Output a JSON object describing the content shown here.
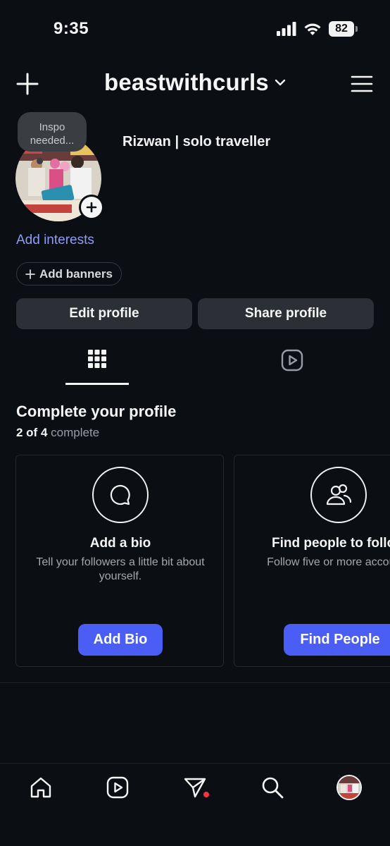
{
  "status_bar": {
    "time": "9:35",
    "battery": "82"
  },
  "header": {
    "username": "beastwithcurls"
  },
  "profile": {
    "note": "Inspo needed...",
    "display_name": "Rizwan | solo traveller",
    "add_interests": "Add interests",
    "add_banners": "Add banners",
    "edit_profile": "Edit profile",
    "share_profile": "Share profile"
  },
  "complete_profile": {
    "title": "Complete your profile",
    "progress_count": "2 of 4",
    "progress_suffix": "complete",
    "cards": [
      {
        "icon": "chat-bubble-icon",
        "title": "Add a bio",
        "description": "Tell your followers a little bit about yourself.",
        "button": "Add Bio"
      },
      {
        "icon": "people-icon",
        "title": "Find people to follow",
        "description": "Follow five or more accounts",
        "button": "Find People"
      }
    ]
  },
  "tabs": [
    {
      "icon": "grid-icon",
      "selected": true
    },
    {
      "icon": "reels-icon",
      "selected": false
    }
  ],
  "bottom_nav": [
    {
      "icon": "home-icon"
    },
    {
      "icon": "reels-icon"
    },
    {
      "icon": "send-icon",
      "badge": "notification-dot"
    },
    {
      "icon": "search-icon"
    },
    {
      "icon": "profile-avatar"
    }
  ],
  "colors": {
    "background": "#0b0e13",
    "accent_button": "#4a5df5",
    "link": "#8e9df5",
    "secondary_button": "#2c3036",
    "notification": "#ff3040"
  }
}
